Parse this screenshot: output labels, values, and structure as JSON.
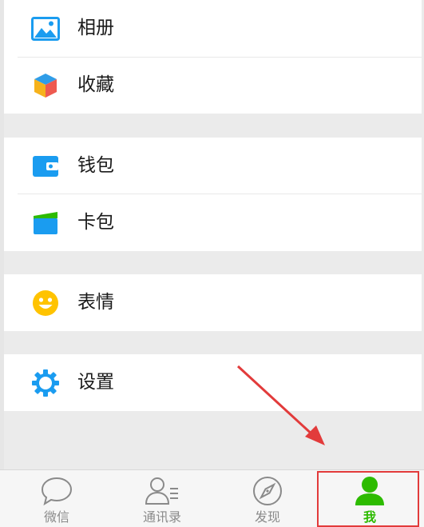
{
  "menu": {
    "album": "相册",
    "favorites": "收藏",
    "wallet": "钱包",
    "cards": "卡包",
    "stickers": "表情",
    "settings": "设置"
  },
  "tabs": [
    {
      "label": "微信",
      "icon": "chat-bubble-icon"
    },
    {
      "label": "通讯录",
      "icon": "contacts-icon"
    },
    {
      "label": "发现",
      "icon": "compass-icon"
    },
    {
      "label": "我",
      "icon": "person-icon",
      "active": true
    }
  ],
  "colors": {
    "active_tab": "#2dbb00",
    "inactive_tab": "#8a8a8a",
    "highlight": "#e23b3b",
    "accent_blue": "#1a9cf0"
  }
}
